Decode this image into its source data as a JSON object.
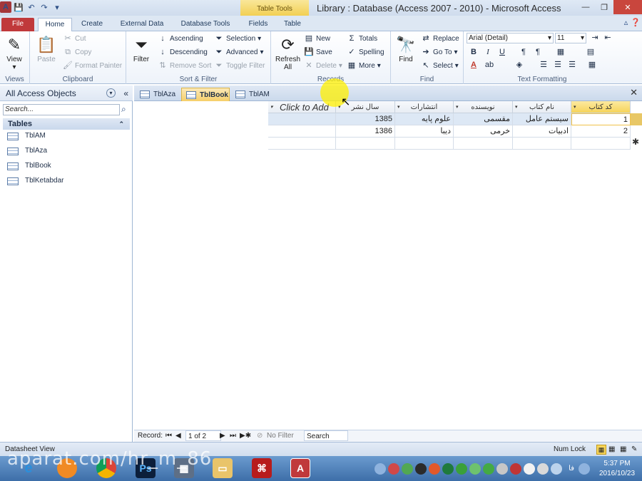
{
  "titlebar": {
    "title": "Library : Database (Access 2007 - 2010) - Microsoft Access",
    "table_tools": "Table Tools",
    "app_logo": "A"
  },
  "ribbon_tabs": [
    "File",
    "Home",
    "Create",
    "External Data",
    "Database Tools",
    "Fields",
    "Table"
  ],
  "groups": {
    "views": {
      "label": "Views",
      "view": "View"
    },
    "clipboard": {
      "label": "Clipboard",
      "paste": "Paste",
      "cut": "Cut",
      "copy": "Copy",
      "format_painter": "Format Painter"
    },
    "sort_filter": {
      "label": "Sort & Filter",
      "filter": "Filter",
      "ascending": "Ascending",
      "descending": "Descending",
      "remove_sort": "Remove Sort",
      "selection": "Selection",
      "advanced": "Advanced",
      "toggle_filter": "Toggle Filter"
    },
    "records": {
      "label": "Records",
      "refresh": "Refresh",
      "refresh2": "All",
      "new": "New",
      "save": "Save",
      "delete": "Delete",
      "totals": "Totals",
      "spelling": "Spelling",
      "more": "More"
    },
    "find": {
      "label": "Find",
      "find": "Find",
      "replace": "Replace",
      "goto": "Go To",
      "select": "Select"
    },
    "text_formatting": {
      "label": "Text Formatting",
      "font": "Arial (Detail)",
      "size": "11",
      "bold": "B",
      "italic": "I",
      "underline": "U"
    }
  },
  "nav": {
    "header": "All Access Objects",
    "search_placeholder": "Search...",
    "section": "Tables",
    "items": [
      "TblAM",
      "TblAza",
      "TblBook",
      "TblKetabdar"
    ]
  },
  "doc_tabs": [
    "TblAza",
    "TblBook",
    "TblAM"
  ],
  "grid": {
    "columns": [
      "کد کتاب",
      "نام کتاب",
      "نویسنده",
      "انتشارات",
      "سال نشر",
      "Click to Add"
    ],
    "rows": [
      {
        "code": "1",
        "name": "سیستم عامل",
        "author": "مقسمی",
        "publisher": "علوم پایه",
        "year": "1385"
      },
      {
        "code": "2",
        "name": "ادبیات",
        "author": "خرمی",
        "publisher": "دیبا",
        "year": "1386"
      }
    ]
  },
  "record_nav": {
    "label": "Record:",
    "position": "1 of 2",
    "filter": "No Filter",
    "search": "Search"
  },
  "status": {
    "left": "Datasheet View",
    "numlock": "Num Lock"
  },
  "taskbar": {
    "lang": "فا",
    "time": "5:37 PM",
    "date": "2016/10/23"
  },
  "watermark": "aparat.com/hr_m_86",
  "colors": {
    "file_tab": "#c0393b",
    "table_tools": "#f2cf53",
    "active_doc_tab": "#f6cf6a",
    "selected_row": "#dde8f5"
  }
}
